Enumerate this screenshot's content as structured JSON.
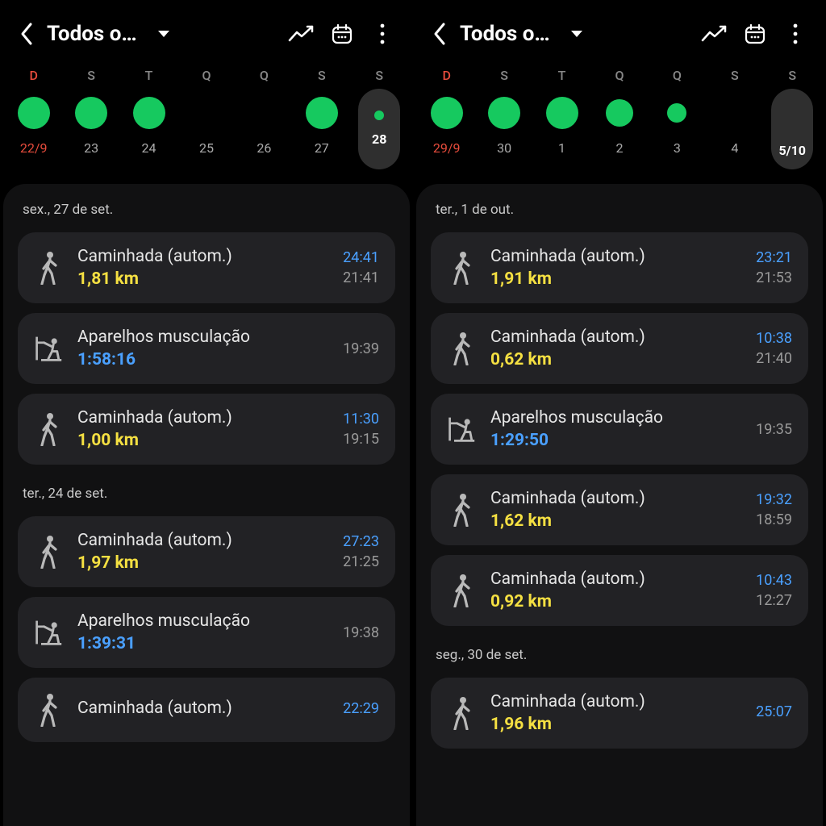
{
  "panes": [
    {
      "title": "Todos o…",
      "week": [
        {
          "dow": "D",
          "sunday": true,
          "date": "22/9",
          "dot": "s40",
          "selected": false
        },
        {
          "dow": "S",
          "date": "23",
          "dot": "s40",
          "selected": false
        },
        {
          "dow": "T",
          "date": "24",
          "dot": "s40",
          "selected": false
        },
        {
          "dow": "Q",
          "date": "25",
          "dot": "none",
          "selected": false
        },
        {
          "dow": "Q",
          "date": "26",
          "dot": "none",
          "selected": false
        },
        {
          "dow": "S",
          "date": "27",
          "dot": "s40",
          "selected": false
        },
        {
          "dow": "S",
          "date": "28",
          "dot": "s12",
          "selected": true
        }
      ],
      "sections": [
        {
          "head": "sex., 27 de set.",
          "entries": [
            {
              "icon": "walk",
              "name": "Caminhada (autom.)",
              "metric": "1,81 km",
              "metric_color": "yellow",
              "dur": "24:41",
              "at": "21:41"
            },
            {
              "icon": "weights",
              "name": "Aparelhos musculação",
              "metric": "1:58:16",
              "metric_color": "blue",
              "dur": "",
              "at": "19:39"
            },
            {
              "icon": "walk",
              "name": "Caminhada (autom.)",
              "metric": "1,00 km",
              "metric_color": "yellow",
              "dur": "11:30",
              "at": "19:15"
            }
          ]
        },
        {
          "head": "ter., 24 de set.",
          "entries": [
            {
              "icon": "walk",
              "name": "Caminhada (autom.)",
              "metric": "1,97 km",
              "metric_color": "yellow",
              "dur": "27:23",
              "at": "21:25"
            },
            {
              "icon": "weights",
              "name": "Aparelhos musculação",
              "metric": "1:39:31",
              "metric_color": "blue",
              "dur": "",
              "at": "19:38"
            },
            {
              "icon": "walk",
              "name": "Caminhada (autom.)",
              "metric": "",
              "metric_color": "yellow",
              "dur": "22:29",
              "at": ""
            }
          ]
        }
      ]
    },
    {
      "title": "Todos o…",
      "week": [
        {
          "dow": "D",
          "sunday": true,
          "date": "29/9",
          "dot": "s40",
          "selected": false
        },
        {
          "dow": "S",
          "date": "30",
          "dot": "s40",
          "selected": false
        },
        {
          "dow": "T",
          "date": "1",
          "dot": "s40",
          "selected": false
        },
        {
          "dow": "Q",
          "date": "2",
          "dot": "s34",
          "selected": false
        },
        {
          "dow": "Q",
          "date": "3",
          "dot": "s24",
          "selected": false
        },
        {
          "dow": "S",
          "date": "4",
          "dot": "none",
          "selected": false
        },
        {
          "dow": "S",
          "date": "5/10",
          "dot": "none",
          "selected": true
        }
      ],
      "sections": [
        {
          "head": "ter., 1 de out.",
          "entries": [
            {
              "icon": "walk",
              "name": "Caminhada (autom.)",
              "metric": "1,91 km",
              "metric_color": "yellow",
              "dur": "23:21",
              "at": "21:53"
            },
            {
              "icon": "walk",
              "name": "Caminhada (autom.)",
              "metric": "0,62 km",
              "metric_color": "yellow",
              "dur": "10:38",
              "at": "21:40"
            },
            {
              "icon": "weights",
              "name": "Aparelhos musculação",
              "metric": "1:29:50",
              "metric_color": "blue",
              "dur": "",
              "at": "19:35"
            },
            {
              "icon": "walk",
              "name": "Caminhada (autom.)",
              "metric": "1,62 km",
              "metric_color": "yellow",
              "dur": "19:32",
              "at": "18:59"
            },
            {
              "icon": "walk",
              "name": "Caminhada (autom.)",
              "metric": "0,92 km",
              "metric_color": "yellow",
              "dur": "10:43",
              "at": "12:27"
            }
          ]
        },
        {
          "head": "seg., 30 de set.",
          "entries": [
            {
              "icon": "walk",
              "name": "Caminhada (autom.)",
              "metric": "1,96 km",
              "metric_color": "yellow",
              "dur": "25:07",
              "at": ""
            }
          ]
        }
      ]
    }
  ]
}
